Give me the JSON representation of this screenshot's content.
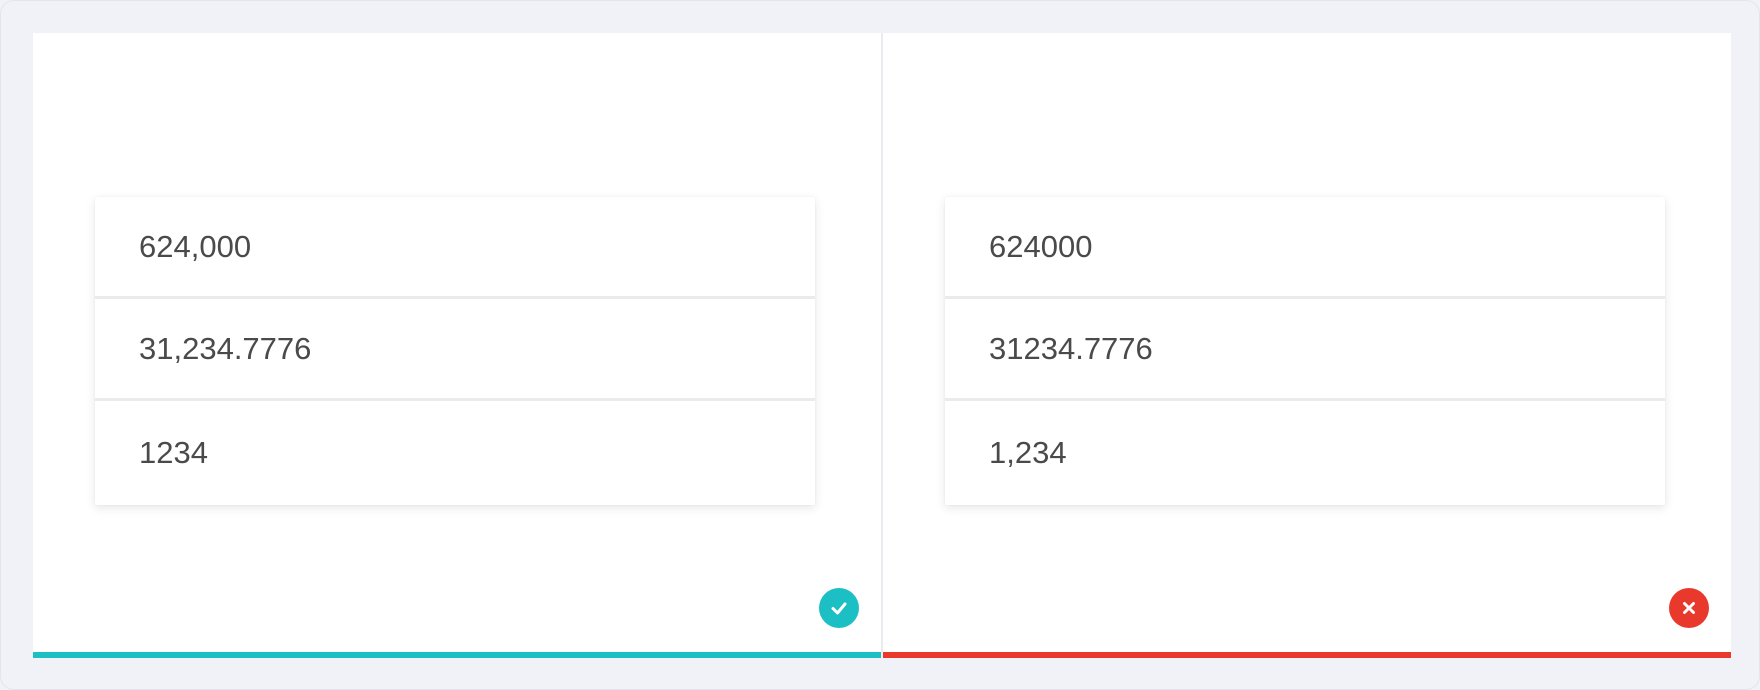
{
  "comparison": {
    "good": {
      "rows": [
        "624,000",
        "31,234.7776",
        "1234"
      ],
      "status": "correct",
      "icon": "check-icon",
      "color": "#1bbfc4"
    },
    "bad": {
      "rows": [
        "624000",
        "31234.7776",
        "1,234"
      ],
      "status": "incorrect",
      "icon": "close-icon",
      "color": "#e8392c"
    }
  }
}
